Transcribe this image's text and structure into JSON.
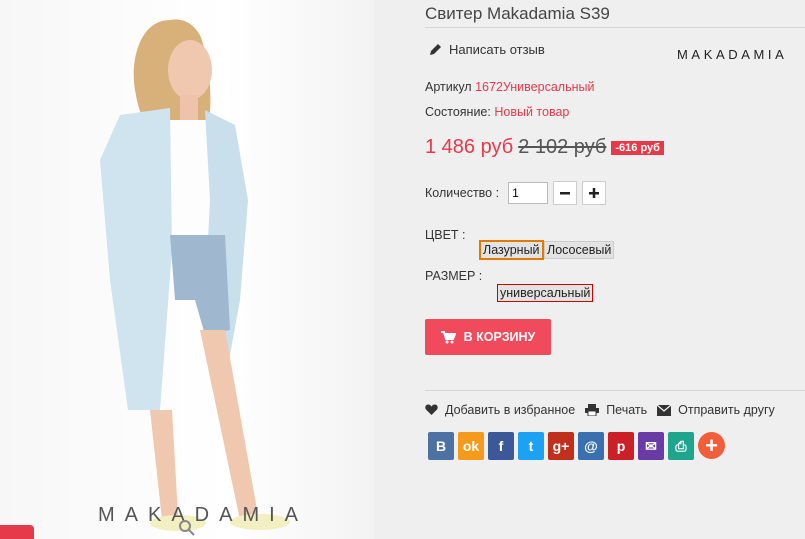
{
  "photo": {
    "watermark": "MAKADAMIA"
  },
  "product": {
    "title": "Свитер Makadamia S39",
    "review_link": "Написать отзыв",
    "brand_logo": "MAKADAMIA",
    "article_label": "Артикул",
    "article_value": "1672Универсальный",
    "condition_label": "Состояние:",
    "condition_value": "Новый товар",
    "price_current": "1 486 руб",
    "price_old": "2 102 руб",
    "discount": "-616 руб",
    "quantity_label": "Количество :",
    "quantity_value": "1",
    "color_label": "ЦВЕТ :",
    "colors": [
      "Лазурный",
      "Лососевый"
    ],
    "size_label": "РАЗМЕР :",
    "sizes": [
      "универсальный"
    ],
    "cart_button": "В КОРЗИНУ"
  },
  "actions": {
    "wishlist": "Добавить в избранное",
    "print": "Печать",
    "send": "Отправить другу"
  },
  "social": [
    {
      "name": "vk",
      "glyph": "В",
      "color": "#4d71a3"
    },
    {
      "name": "odnoklassniki",
      "glyph": "ok",
      "color": "#f59a1b"
    },
    {
      "name": "facebook",
      "glyph": "f",
      "color": "#3b5998"
    },
    {
      "name": "twitter",
      "glyph": "t",
      "color": "#1da1f2"
    },
    {
      "name": "google-plus",
      "glyph": "g+",
      "color": "#c1301c"
    },
    {
      "name": "mail",
      "glyph": "@",
      "color": "#3a6fb0"
    },
    {
      "name": "pinterest",
      "glyph": "p",
      "color": "#cb2027"
    },
    {
      "name": "email",
      "glyph": "✉",
      "color": "#6a3aa5"
    },
    {
      "name": "print",
      "glyph": "⎙",
      "color": "#1fa58d"
    },
    {
      "name": "more",
      "glyph": "+",
      "color": "#f05f3a"
    }
  ],
  "colors": {
    "accent": "#e63a4b",
    "cart_button": "#f04a5c"
  }
}
